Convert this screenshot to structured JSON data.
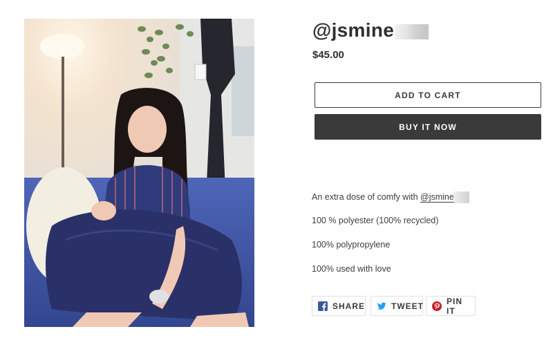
{
  "product": {
    "title": "@jsmine",
    "price": "$45.00"
  },
  "actions": {
    "add_to_cart_label": "ADD TO CART",
    "buy_now_label": "BUY IT NOW"
  },
  "description": {
    "line1_prefix": "An extra dose of comfy with ",
    "line1_mention": "@jsmine",
    "line2": "100 % polyester (100% recycled)",
    "line3": "100% polypropylene",
    "line4": "100% used with love"
  },
  "share": {
    "facebook_label": "SHARE",
    "twitter_label": "TWEET",
    "pinterest_label": "PIN IT",
    "icons": {
      "facebook": "facebook-icon",
      "twitter": "twitter-icon",
      "pinterest": "pinterest-icon"
    }
  },
  "colors": {
    "primary_button": "#3a3a3a",
    "facebook": "#3b5998",
    "twitter": "#1da1f2",
    "pinterest": "#cb2027"
  }
}
